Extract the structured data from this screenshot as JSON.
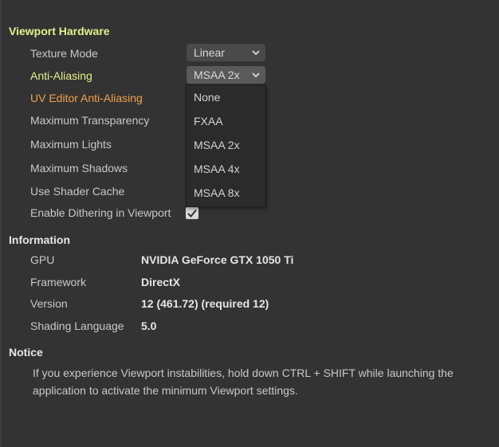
{
  "viewport_hardware": {
    "title": "Viewport Hardware",
    "texture_mode_label": "Texture Mode",
    "texture_mode_value": "Linear",
    "anti_aliasing_label": "Anti-Aliasing",
    "anti_aliasing_value": "MSAA 2x",
    "uv_editor_aa_label": "UV Editor Anti-Aliasing",
    "max_transparency_label": "Maximum Transparency",
    "max_lights_label": "Maximum Lights",
    "max_shadows_label": "Maximum Shadows",
    "shader_cache_label": "Use Shader Cache",
    "dithering_label": "Enable Dithering in Viewport",
    "dithering_checked": true
  },
  "aa_dropdown": {
    "options": [
      "None",
      "FXAA",
      "MSAA 2x",
      "MSAA 4x",
      "MSAA 8x"
    ]
  },
  "information": {
    "title": "Information",
    "rows": [
      {
        "label": "GPU",
        "value": "NVIDIA GeForce GTX 1050 Ti"
      },
      {
        "label": "Framework",
        "value": "DirectX"
      },
      {
        "label": "Version",
        "value": "12 (461.72) (required 12)"
      },
      {
        "label": "Shading Language",
        "value": "5.0"
      }
    ]
  },
  "notice": {
    "title": "Notice",
    "text": "If you experience Viewport instabilities, hold down CTRL + SHIFT while launching the application to activate the minimum Viewport settings."
  },
  "colors": {
    "background": "#333333",
    "section_highlight": "#e6f08a",
    "warning_orange": "#f0a050"
  }
}
